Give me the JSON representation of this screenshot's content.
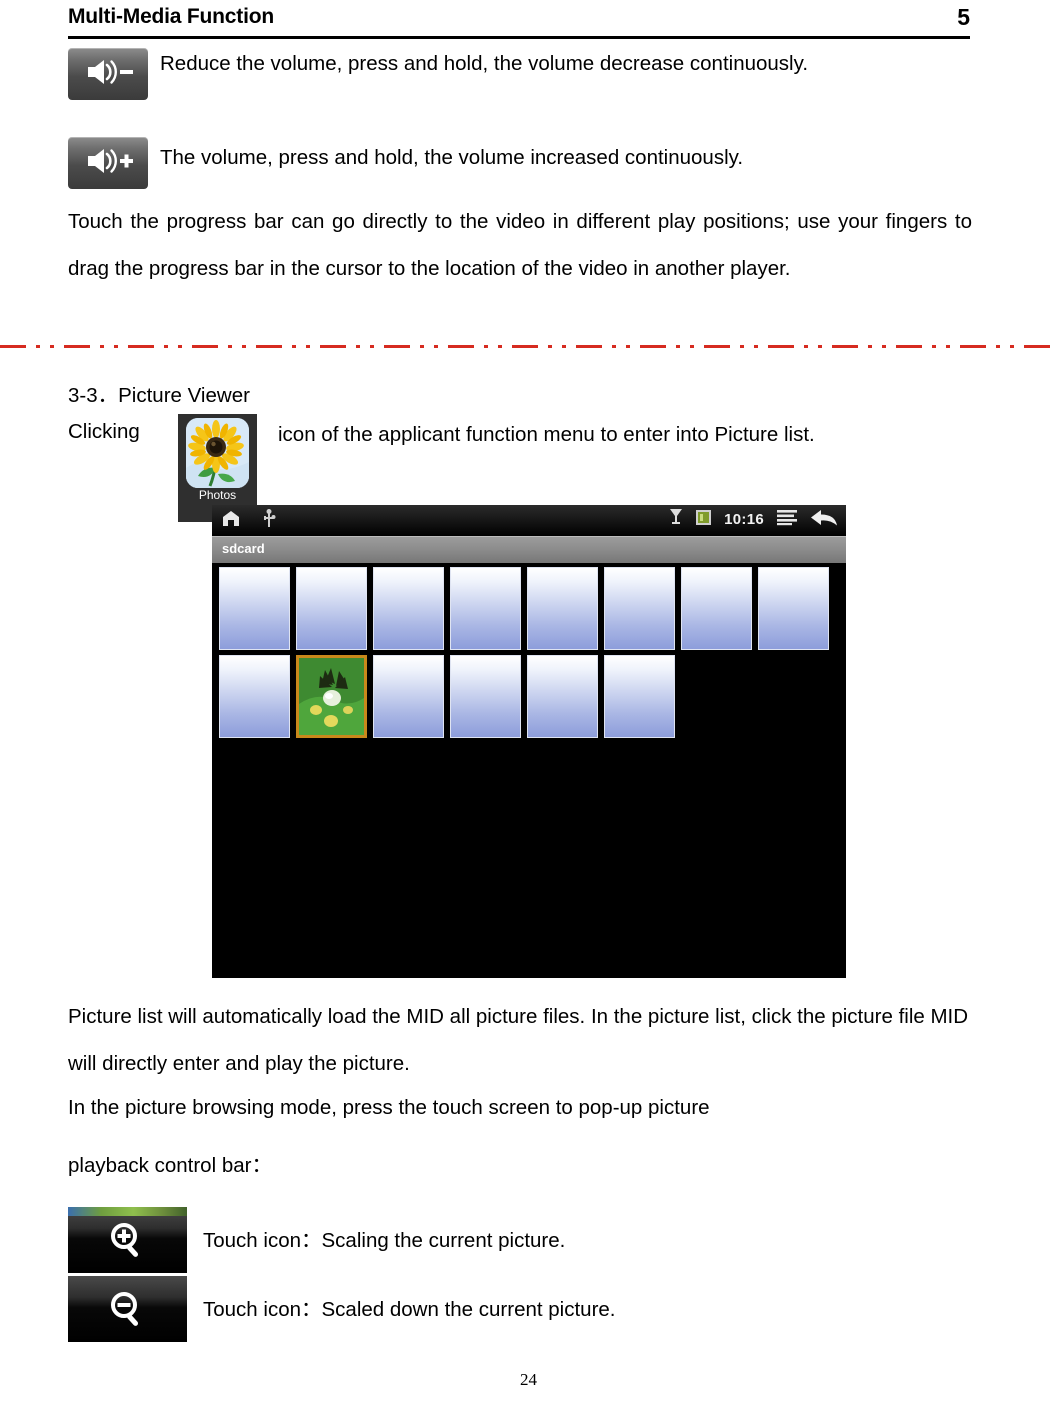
{
  "header": {
    "title": "Multi-Media Function",
    "chapter_number": "5"
  },
  "volume_controls": [
    {
      "icon": "volume-down-icon",
      "text": "Reduce the volume, press and hold, the volume decrease continuously."
    },
    {
      "icon": "volume-up-icon",
      "text": "The volume, press and hold, the volume increased continuously."
    }
  ],
  "paragraphs": {
    "progress_bar": "Touch the progress bar can go directly to the video in different play positions; use your fingers to drag the progress bar in the cursor to the location of the video in another player.",
    "picture_list": "Picture list will automatically load the MID all picture files. In the picture list, click the picture file MID will directly enter and play the picture.",
    "browsing_mode": "In the picture browsing mode, press the touch screen to pop-up picture",
    "playback_bar": "playback control bar："
  },
  "section": {
    "heading": "3-3．Picture Viewer",
    "clicking_prefix": "Clicking",
    "clicking_suffix": "icon of the applicant function menu to enter into Picture list.",
    "app_icon_label": "Photos"
  },
  "android_screenshot": {
    "status_bar": {
      "home_icon": "home-icon",
      "usb_icon": "usb-icon",
      "signal_icon": "signal-icon",
      "battery_icon": "battery-icon",
      "clock": "10:16",
      "menu_icon": "menu-lines-icon",
      "back_icon": "back-arrow-icon"
    },
    "path_label": "sdcard",
    "thumbnails": {
      "total": 14,
      "row_counts": [
        8,
        6
      ],
      "selected_index": 9
    }
  },
  "zoom_controls": [
    {
      "icon": "zoom-in-icon",
      "text": "Touch icon：Scaling the current picture."
    },
    {
      "icon": "zoom-out-icon",
      "text": "Touch icon：Scaled down the current picture."
    }
  ],
  "footer": {
    "page_number": "24"
  },
  "colors": {
    "separator": "#d62b20",
    "selection_border": "#c9881b",
    "text": "#000000"
  }
}
